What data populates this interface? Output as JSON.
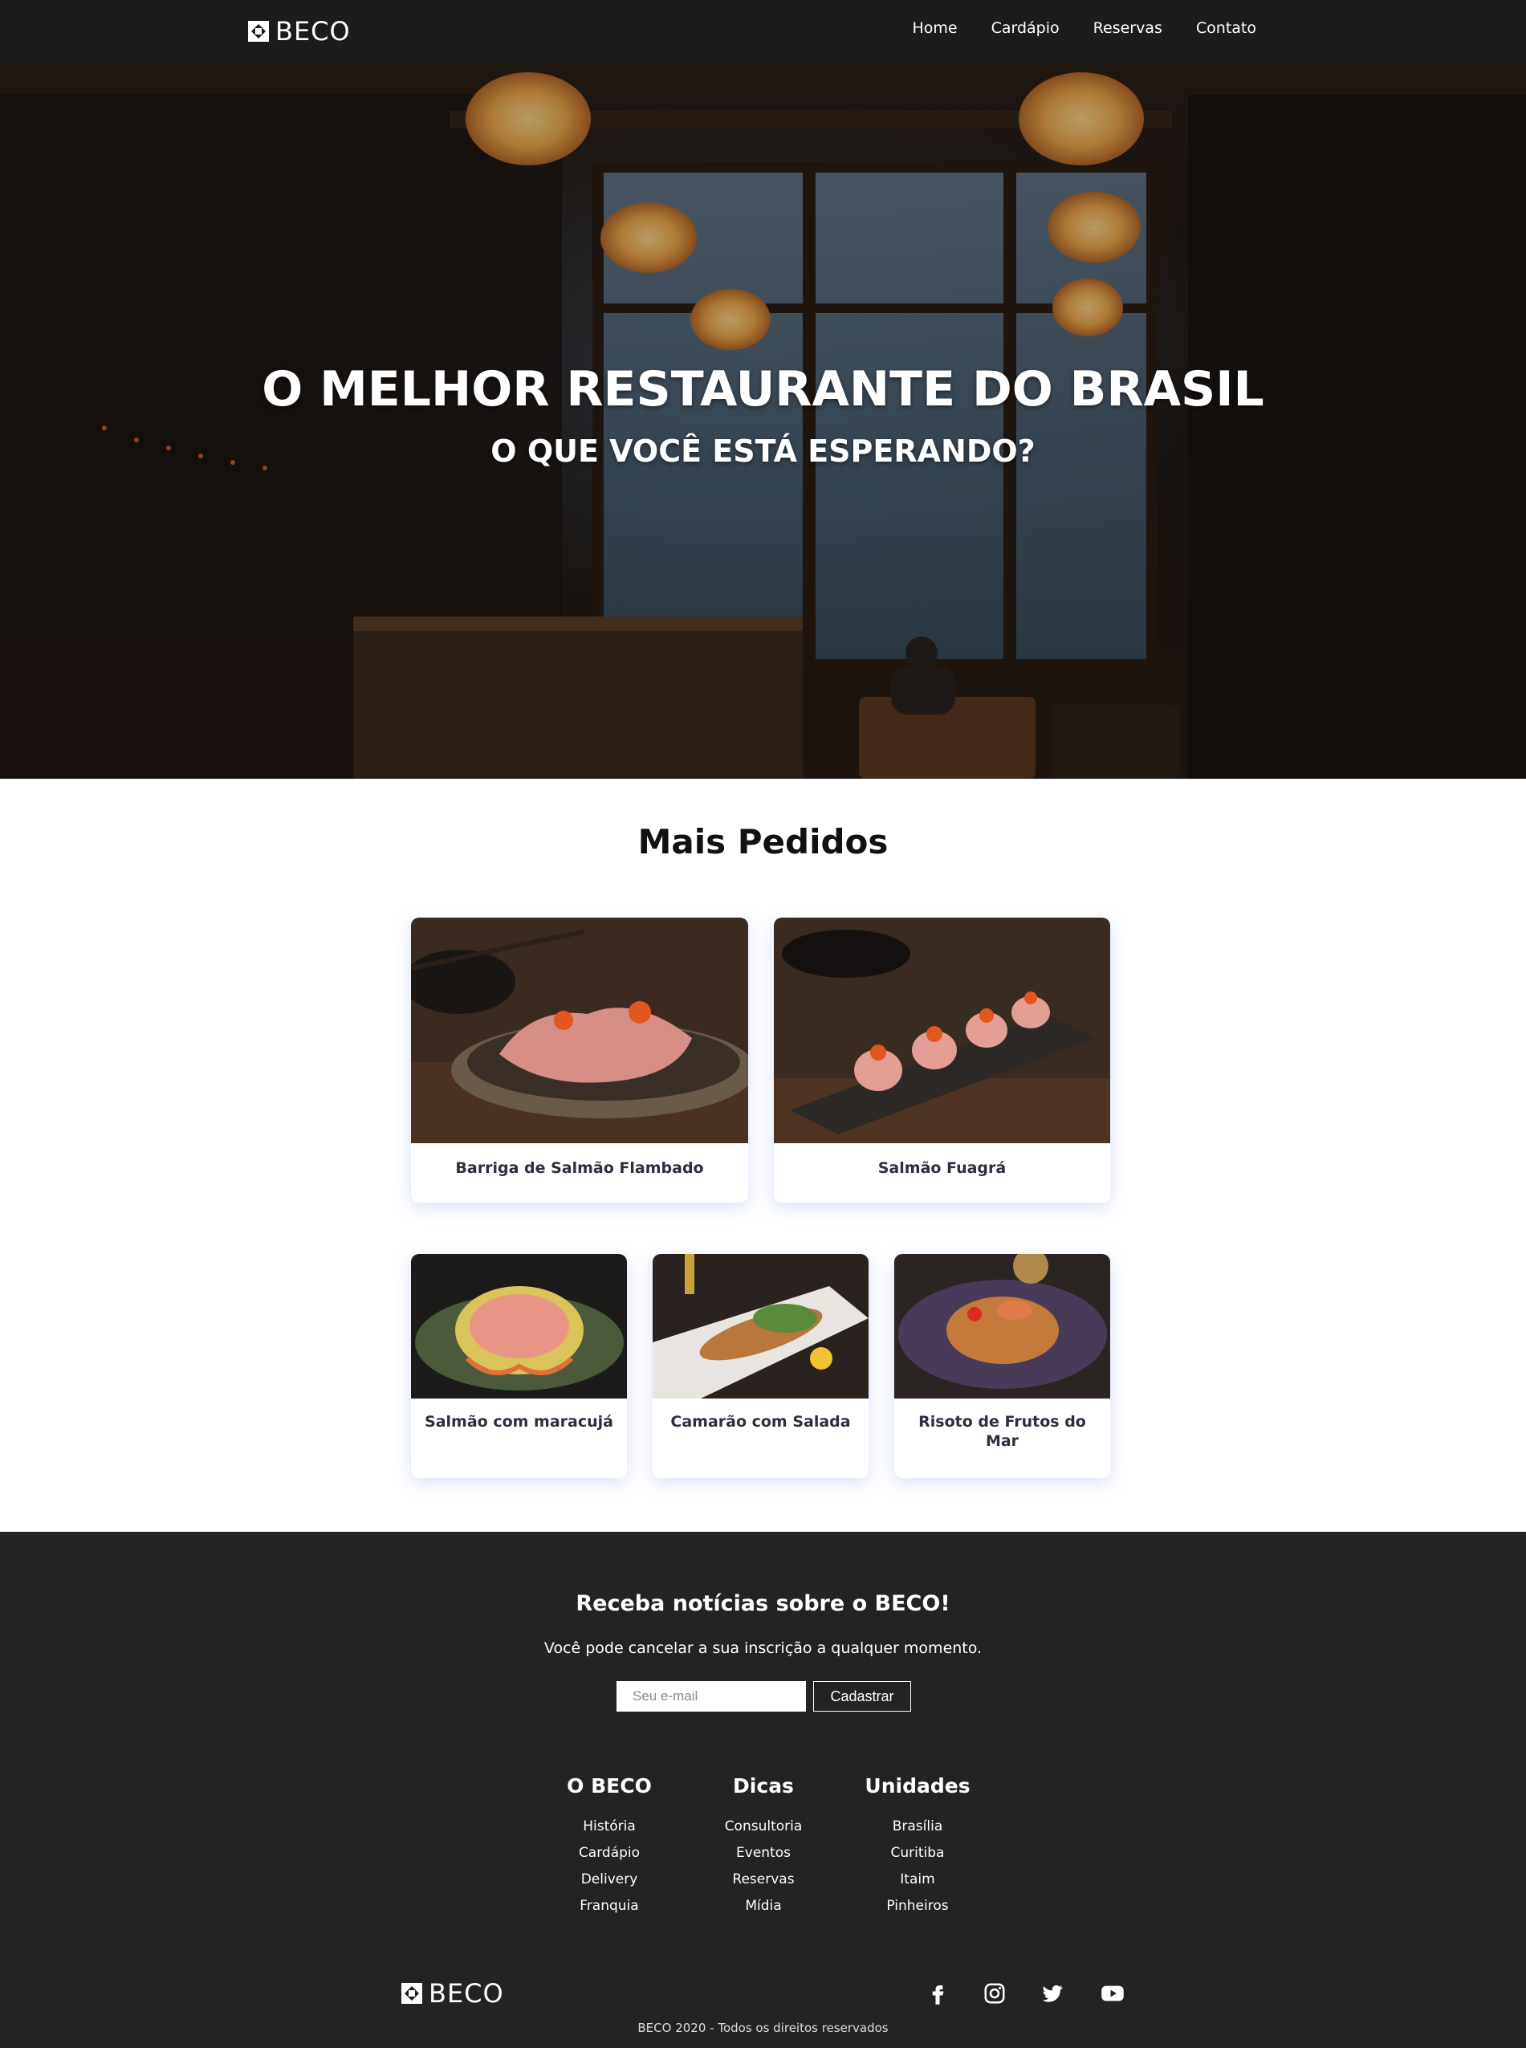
{
  "brand": {
    "name": "BECO"
  },
  "nav": {
    "items": [
      "Home",
      "Cardápio",
      "Reservas",
      "Contato"
    ]
  },
  "hero": {
    "title": "O MELHOR RESTAURANTE DO BRASIL",
    "subtitle": "O QUE VOCÊ ESTÁ ESPERANDO?"
  },
  "featured": {
    "title": "Mais Pedidos",
    "items": [
      "Barriga de Salmão Flambado",
      "Salmão Fuagrá",
      "Salmão com maracujá",
      "Camarão com Salada",
      "Risoto de Frutos do Mar"
    ]
  },
  "newsletter": {
    "title": "Receba notícias sobre o BECO!",
    "text": "Você pode cancelar a sua inscrição a qualquer momento.",
    "placeholder": "Seu e-mail",
    "button": "Cadastrar"
  },
  "footer": {
    "columns": [
      {
        "title": "O BECO",
        "links": [
          "História",
          "Cardápio",
          "Delivery",
          "Franquia"
        ]
      },
      {
        "title": "Dicas",
        "links": [
          "Consultoria",
          "Eventos",
          "Reservas",
          "Mídia"
        ]
      },
      {
        "title": "Unidades",
        "links": [
          "Brasília",
          "Curitiba",
          "Itaim",
          "Pinheiros"
        ]
      }
    ],
    "social": [
      "facebook-icon",
      "instagram-icon",
      "twitter-icon",
      "youtube-icon"
    ],
    "copyright": "BECO 2020 - Todos os direitos reservados"
  },
  "colors": {
    "nav_bg": "#1c1c1c",
    "footer_bg": "#232323",
    "card_label": "#2c2f3d"
  }
}
